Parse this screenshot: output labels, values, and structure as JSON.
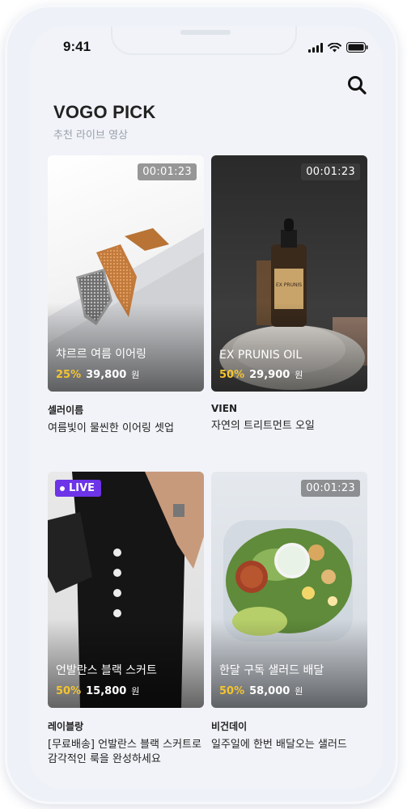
{
  "status": {
    "time": "9:41"
  },
  "header": {
    "title": "VOGO PICK",
    "subtitle": "추천 라이브 영상"
  },
  "icons": {
    "search": "search-icon",
    "signal": "signal-icon",
    "wifi": "wifi-icon",
    "battery": "battery-icon"
  },
  "colors": {
    "live_badge": "#6d34e8",
    "discount": "#f4c430"
  },
  "cards": [
    {
      "duration": "00:01:23",
      "product_name": "챠르르 여름 이어링",
      "discount": "25%",
      "price": "39,800",
      "currency": "원",
      "seller": "셀러이름",
      "description": "여름빛이 물씬한 이어링 셋업"
    },
    {
      "duration": "00:01:23",
      "product_name": "EX PRUNIS OIL",
      "discount": "50%",
      "price": "29,900",
      "currency": "원",
      "seller": "VIEN",
      "description": "자연의 트리트먼트 오일"
    },
    {
      "live_label": "LIVE",
      "product_name": "언발란스 블랙 스커트",
      "discount": "50%",
      "price": "15,800",
      "currency": "원",
      "seller": "레이블랑",
      "description": "[무료배송] 언발란스 블랙 스커트로 감각적인 룩을 완성하세요"
    },
    {
      "duration": "00:01:23",
      "product_name": "한달 구독 샐러드 배달",
      "discount": "50%",
      "price": "58,000",
      "currency": "원",
      "seller": "비건데이",
      "description": "일주일에 한번 배달오는 샐러드"
    }
  ]
}
